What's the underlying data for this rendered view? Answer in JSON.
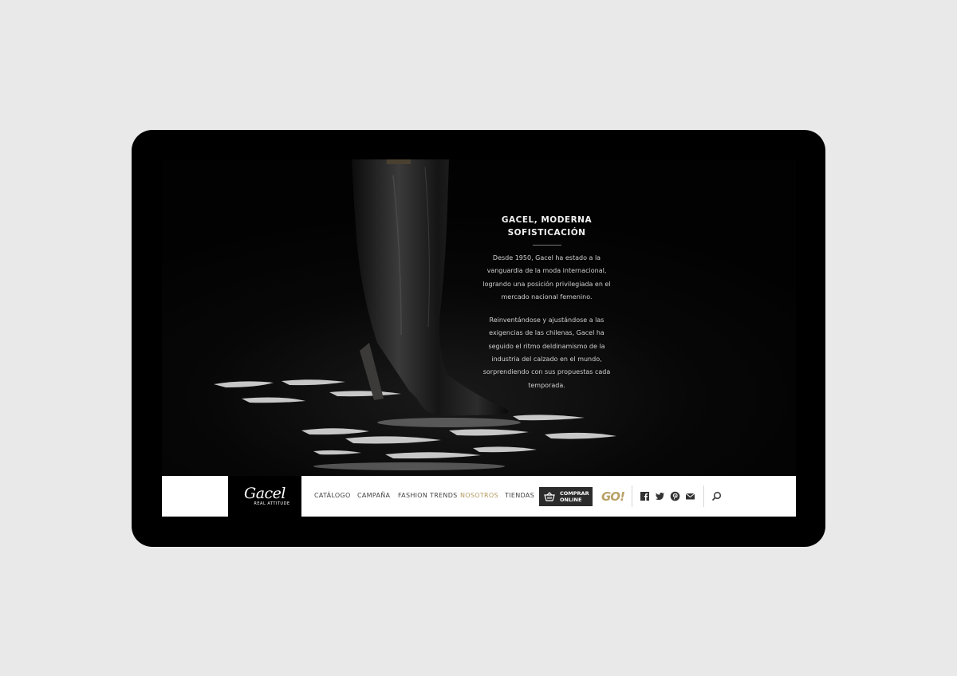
{
  "hero": {
    "title_line1": "GACEL, MODERNA",
    "title_line2": "SOFISTICACIÓN",
    "paragraph1": "Desde 1950, Gacel ha estado a la vanguardia de la moda internacional, logrando una posición privilegiada en el mercado nacional femenino.",
    "paragraph2": "Reinventándose y ajustándose a las exigencias de las chilenas, Gacel ha seguido el ritmo deldinamismo de la industria del calzado en el mundo, sorprendiendo con sus propuestas cada temporada."
  },
  "brand": {
    "logo_text": "Gacel",
    "tagline": "REAL ATTITUDE"
  },
  "nav": {
    "items": [
      {
        "label": "CATÁLOGO",
        "active": false
      },
      {
        "label": "CAMPAÑA",
        "active": false
      },
      {
        "label": "FASHION TRENDS",
        "active": false
      },
      {
        "label": "NOSOTROS",
        "active": true
      },
      {
        "label": "TIENDAS",
        "active": false
      }
    ],
    "buy_button": "COMPRAR ONLINE",
    "go_logo": "GO!"
  },
  "social": [
    "facebook-icon",
    "twitter-icon",
    "pinterest-icon",
    "mail-icon"
  ],
  "search_icon": "search-icon",
  "colors": {
    "active_nav": "#b29a5e",
    "go_gold": "#b9a267",
    "button_bg": "#2b2b2b"
  }
}
